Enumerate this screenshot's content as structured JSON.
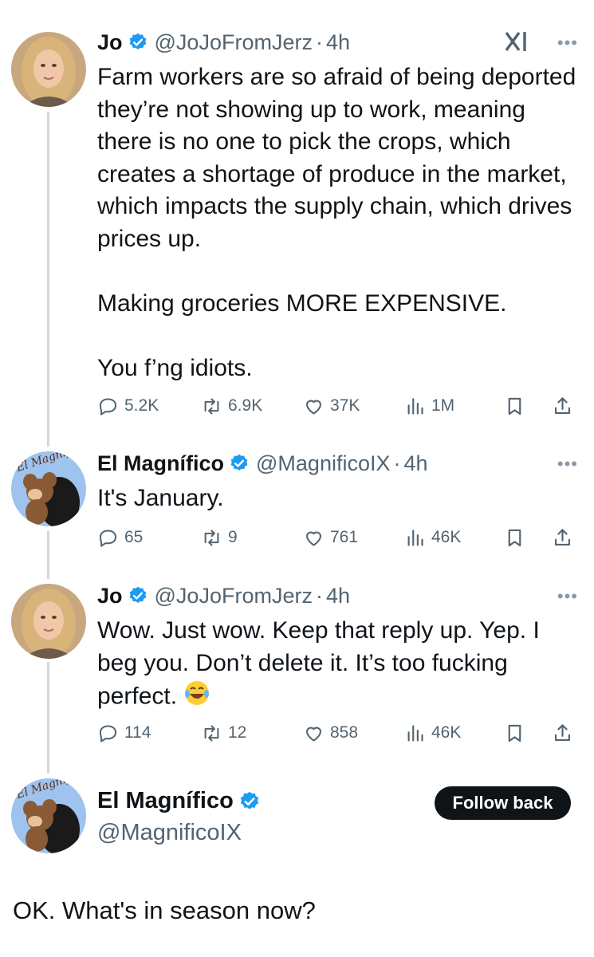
{
  "tweets": [
    {
      "name": "Jo",
      "handle": "@JoJoFromJerz",
      "dot": "·",
      "time": "4h",
      "text": "Farm workers are so afraid of being deported they’re not showing up to work, meaning there is no one to pick the crops, which creates a shortage of produce in the market, which impacts the supply chain, which drives prices up.\n\nMaking groceries MORE EXPENSIVE.\n\nYou f’ng idiots.",
      "replies": "5.2K",
      "retweets": "6.9K",
      "likes": "37K",
      "views": "1M"
    },
    {
      "name": "El Magnífico",
      "handle": "@MagnificoIX",
      "dot": "·",
      "time": "4h",
      "text": "It's January.",
      "replies": "65",
      "retweets": "9",
      "likes": "761",
      "views": "46K"
    },
    {
      "name": "Jo",
      "handle": "@JoJoFromJerz",
      "dot": "·",
      "time": "4h",
      "text": "Wow. Just wow. Keep that reply up. Yep. I beg you. Don’t delete it. It’s too fucking perfect. ",
      "emoji": "😂",
      "replies": "114",
      "retweets": "12",
      "likes": "858",
      "views": "46K"
    }
  ],
  "profile": {
    "name": "El Magnífico",
    "handle": "@MagnificoIX",
    "follow_label": "Follow back",
    "avatar_text": "El Magnifico"
  },
  "final_text": "OK. What's in season now?",
  "icons": {
    "more": "more-icon",
    "grok": "grok-icon",
    "verified": "verified-badge-icon"
  },
  "colors": {
    "text": "#0f1419",
    "secondary": "#536471",
    "verified": "#1d9bf0",
    "thread_line": "#cfd9de"
  }
}
